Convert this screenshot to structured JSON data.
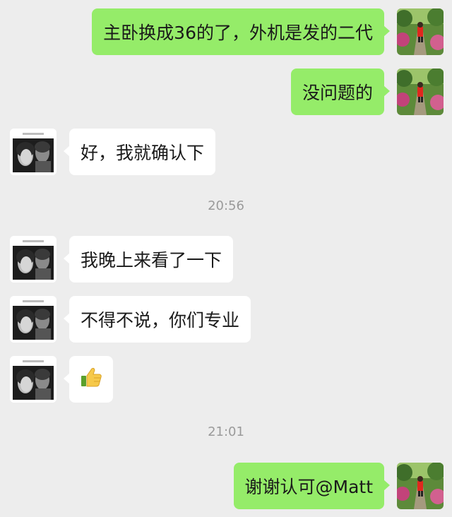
{
  "messages": [
    {
      "text": "主卧换成36的了，外机是发的二代"
    },
    {
      "text": "没问题的"
    },
    {
      "text": "好，我就确认下"
    },
    {
      "text": "我晚上来看了一下"
    },
    {
      "text": "不得不说，你们专业"
    },
    {
      "icon": "thumbs-up-icon"
    },
    {
      "text": "谢谢认可@Matt"
    }
  ],
  "timestamps": [
    "20:56",
    "21:01"
  ],
  "colors": {
    "background": "#ededed",
    "self_bubble": "#95ec69",
    "other_bubble": "#ffffff",
    "timestamp": "#9a9a9a"
  }
}
